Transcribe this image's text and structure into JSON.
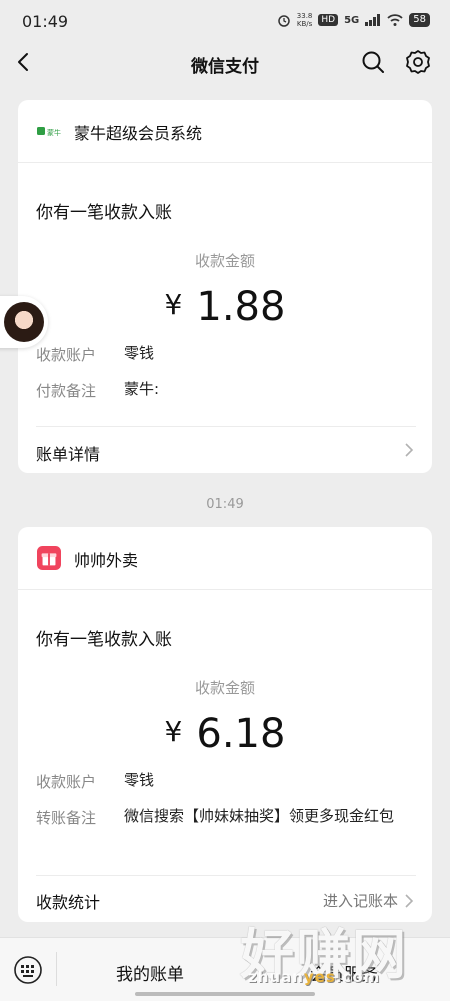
{
  "status": {
    "time": "01:49",
    "net_speed": "33.8",
    "net_unit": "KB/s",
    "hd": "HD",
    "net": "5G",
    "battery": "58"
  },
  "nav": {
    "title": "微信支付"
  },
  "card1": {
    "merchant": "蒙牛超级会员系统",
    "logo_text": "蒙牛",
    "notice": "你有一笔收款入账",
    "amount_label": "收款金额",
    "currency": "¥",
    "amount": "1.88",
    "rows": [
      {
        "label": "收款账户",
        "value": "零钱"
      },
      {
        "label": "付款备注",
        "value": "蒙牛:"
      }
    ],
    "footer_label": "账单详情"
  },
  "timestamp": "01:49",
  "card2": {
    "merchant": "帅帅外卖",
    "notice": "你有一笔收款入账",
    "amount_label": "收款金额",
    "currency": "¥",
    "amount": "6.18",
    "rows": [
      {
        "label": "收款账户",
        "value": "零钱"
      },
      {
        "label": "转账备注",
        "value": "微信搜索【帅妹妹抽奖】领更多现金红包"
      }
    ],
    "footer_label": "收款统计",
    "footer_link": "进入记账本"
  },
  "bottom": {
    "tab1": "我的账单",
    "tab2": "会员服务"
  },
  "watermark": {
    "text": "好赚网",
    "url_prefix": "zhuan",
    "url_highlight": "yes",
    "url_suffix": ".com"
  },
  "colors": {
    "background": "#ededed",
    "card": "#ffffff",
    "logo_green": "#2f9e44",
    "logo_red": "#f0445d"
  },
  "icons": [
    "back-icon",
    "search-icon",
    "settings-icon",
    "chevron-right-icon",
    "keyboard-icon"
  ]
}
